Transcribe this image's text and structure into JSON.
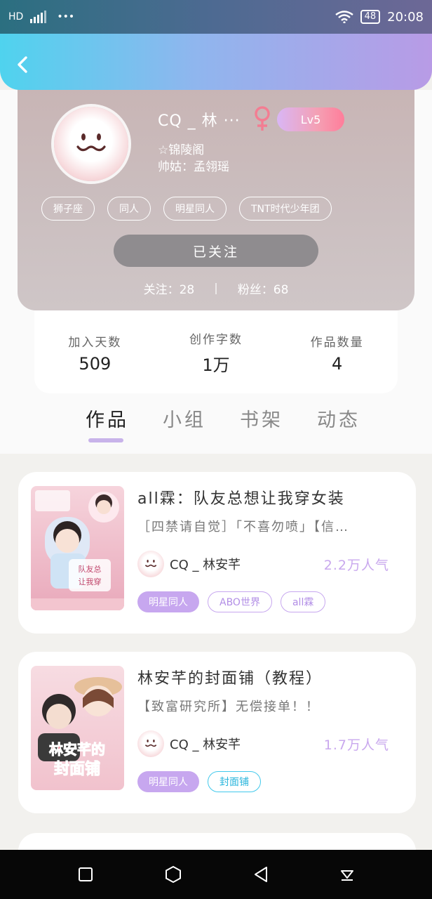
{
  "status_bar": {
    "network": "HD",
    "battery": "48",
    "time": "20:08"
  },
  "profile": {
    "username": "CQ _ 林 ···",
    "level": "Lv5",
    "bio_line1": "☆锦陵阁",
    "bio_line2": "帅姑：孟翎瑶",
    "tags": [
      "狮子座",
      "同人",
      "明星同人",
      "TNT时代少年团"
    ],
    "follow_button": "已关注",
    "following": "关注：28",
    "fans": "粉丝：68"
  },
  "stats": [
    {
      "label": "加入天数",
      "value": "509"
    },
    {
      "label": "创作字数",
      "value": "1万"
    },
    {
      "label": "作品数量",
      "value": "4"
    }
  ],
  "tabs": [
    "作品",
    "小组",
    "书架",
    "动态"
  ],
  "active_tab": "作品",
  "works": [
    {
      "title": "all霖：队友总想让我穿女装",
      "desc": "［四禁请自觉］「不喜勿喷」【信…",
      "author": "CQ _ 林安芊",
      "popularity": "2.2万人气",
      "tags": [
        "明星同人",
        "ABO世界",
        "all霖"
      ],
      "cover_text": "队友总想让我穿女装"
    },
    {
      "title": "林安芊的封面铺（教程）",
      "desc": "【致富研究所】无偿接单！！",
      "author": "CQ _ 林安芊",
      "popularity": "1.7万人气",
      "tags": [
        "明星同人",
        "封面铺"
      ],
      "cover_text": "林安芊的封面铺"
    }
  ],
  "colors": {
    "accent_purple": "#c7a7ef",
    "accent_cyan": "#42c9ec",
    "header_gradient_start": "#4fd3ee",
    "header_gradient_end": "#b89be6"
  }
}
